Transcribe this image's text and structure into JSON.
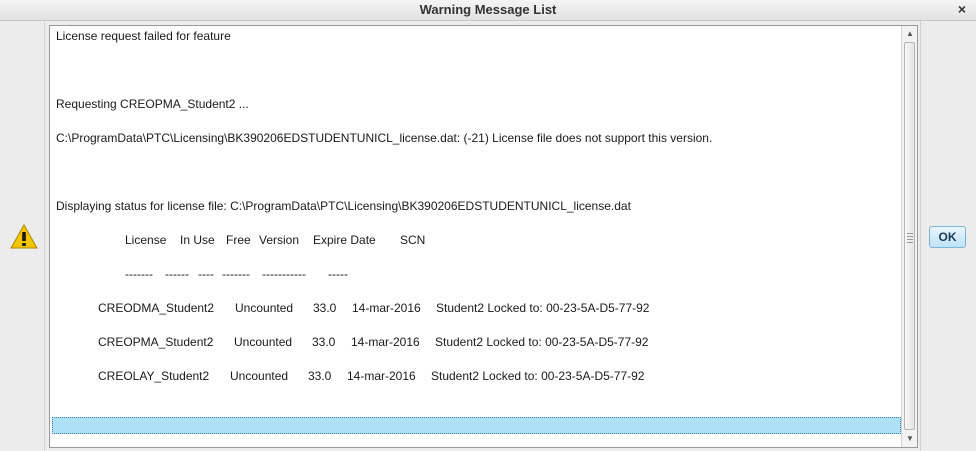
{
  "window": {
    "title": "Warning Message List",
    "close_glyph": "×"
  },
  "icons": {
    "warning": "warning-triangle-icon",
    "close": "close-icon"
  },
  "colors": {
    "selection": "#aee0f7",
    "warning_yellow": "#f5c400",
    "ok_button": "#bfe2f8"
  },
  "messages": {
    "line1": "License request failed for feature",
    "line2": "Requesting CREOPMA_Student2 ...",
    "line3": "C:\\ProgramData\\PTC\\Licensing\\BK390206EDSTUDENTUNICL_license.dat: (-21) License file does not support this version.",
    "line4": "Displaying status for license file: C:\\ProgramData\\PTC\\Licensing\\BK390206EDSTUDENTUNICL_license.dat",
    "header": {
      "license": "License",
      "in_use": "In Use",
      "free": "Free",
      "version": "Version",
      "expire": "Expire Date",
      "scn": "SCN"
    },
    "dashes": {
      "license": "-------",
      "in_use": "------",
      "free": "----",
      "version": "-------",
      "expire": "-----------",
      "scn": "-----"
    },
    "rows": [
      {
        "name": "CREODMA_Student2",
        "status": "Uncounted",
        "version": "33.0",
        "date": "14-mar-2016",
        "scn": "Student2 Locked to: 00-23-5A-D5-77-92"
      },
      {
        "name": "CREOPMA_Student2",
        "status": "Uncounted",
        "version": "33.0",
        "date": "14-mar-2016",
        "scn": "Student2 Locked to: 00-23-5A-D5-77-92"
      },
      {
        "name": "CREOLAY_Student2",
        "status": "Uncounted",
        "version": "33.0",
        "date": "14-mar-2016",
        "scn": "Student2 Locked to: 00-23-5A-D5-77-92"
      }
    ]
  },
  "buttons": {
    "ok": "OK"
  }
}
